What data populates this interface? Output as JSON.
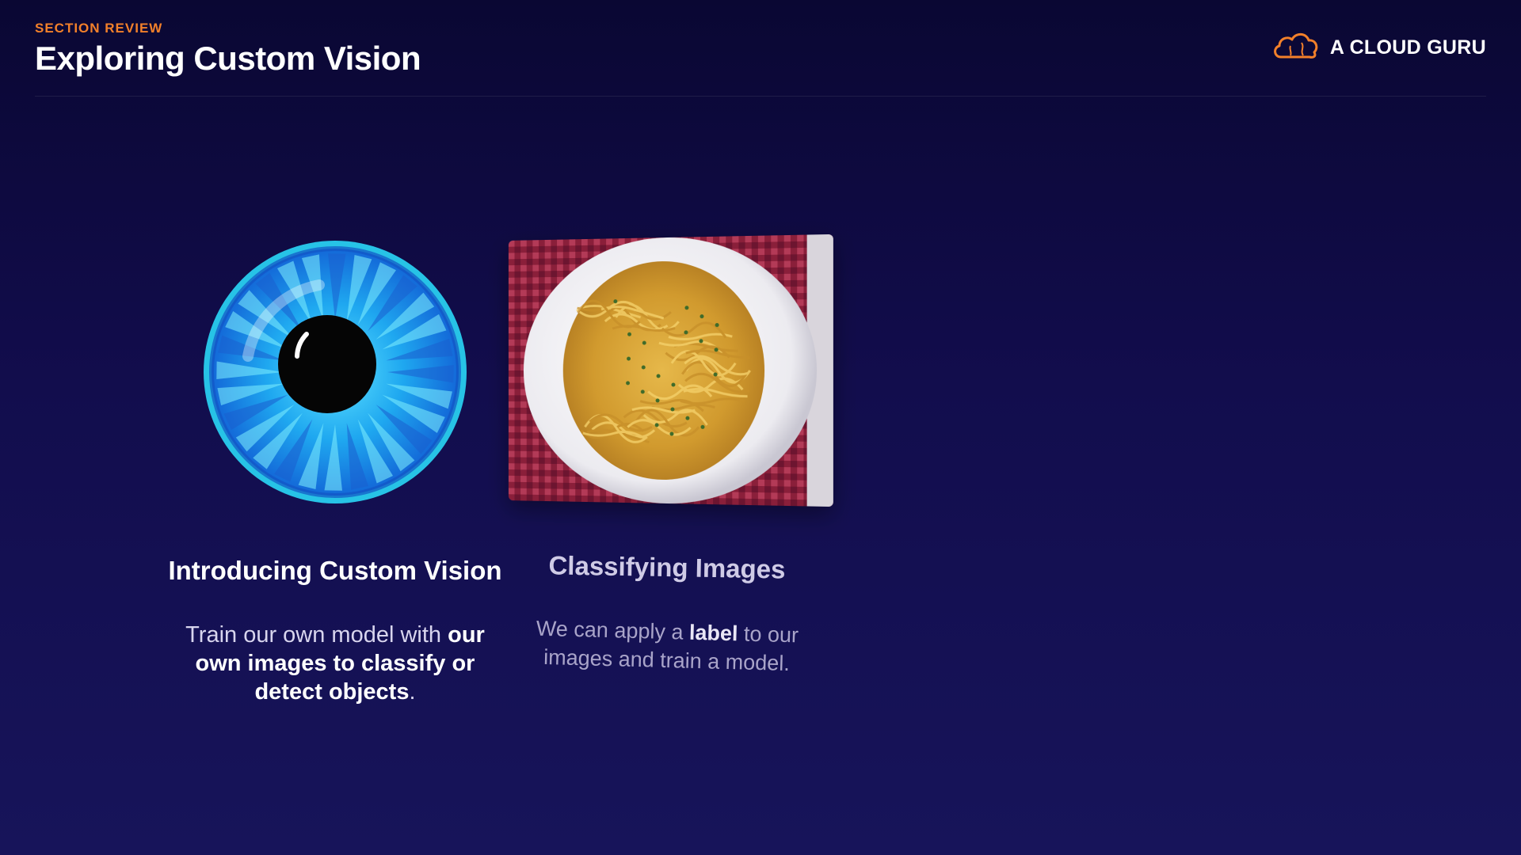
{
  "header": {
    "eyebrow": "SECTION REVIEW",
    "title": "Exploring Custom Vision"
  },
  "brand": {
    "name": "A CLOUD GURU",
    "logo_icon": "cloud-logo-icon",
    "accent_color": "#f2802a"
  },
  "cards": [
    {
      "image_icon": "eye-icon",
      "heading": "Introducing Custom Vision",
      "body_prefix": "Train our own model with ",
      "body_bold": "our own images to classify or detect objects",
      "body_suffix": "."
    },
    {
      "image_icon": "spaghetti-plate-image",
      "heading": "Classifying Images",
      "body_prefix": "We can apply a ",
      "body_bold": "label",
      "body_suffix": " to our images and train a model."
    }
  ],
  "colors": {
    "background_top": "#0a0733",
    "background_bottom": "#17145a",
    "eyebrow": "#f2802a"
  }
}
